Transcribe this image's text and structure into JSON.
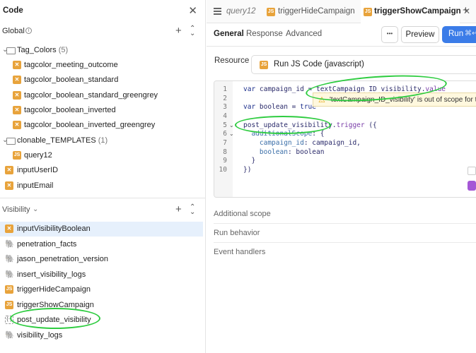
{
  "left": {
    "header_title": "Code",
    "global": {
      "title": "Global",
      "items": [
        {
          "label": "Tag_Colors",
          "count": "(5)",
          "kind": "folder"
        },
        {
          "label": "tagcolor_meeting_outcome",
          "kind": "variable"
        },
        {
          "label": "tagcolor_boolean_standard",
          "kind": "variable"
        },
        {
          "label": "tagcolor_boolean_standard_greengrey",
          "kind": "variable"
        },
        {
          "label": "tagcolor_boolean_inverted",
          "kind": "variable"
        },
        {
          "label": "tagcolor_boolean_inverted_greengrey",
          "kind": "variable"
        },
        {
          "label": "clonable_TEMPLATES",
          "count": "(1)",
          "kind": "folder"
        },
        {
          "label": "query12",
          "kind": "js"
        },
        {
          "label": "inputUserID",
          "kind": "variable"
        },
        {
          "label": "inputEmail",
          "kind": "variable"
        }
      ]
    },
    "visibility": {
      "title": "Visibility",
      "items": [
        {
          "label": "inputVisibilityBoolean",
          "kind": "variable"
        },
        {
          "label": "penetration_facts",
          "kind": "postgres"
        },
        {
          "label": "jason_penetration_version",
          "kind": "postgres"
        },
        {
          "label": "insert_visibility_logs",
          "kind": "postgres"
        },
        {
          "label": "triggerHideCampaign",
          "kind": "js"
        },
        {
          "label": "triggerShowCampaign",
          "kind": "js"
        },
        {
          "label": "post_update_visibility",
          "kind": "workflow"
        },
        {
          "label": "visibility_logs",
          "kind": "postgres"
        }
      ]
    }
  },
  "tabs": {
    "items": [
      "query12",
      "triggerHideCampaign",
      "triggerShowCampaign"
    ],
    "active": "triggerShowCampaign"
  },
  "subtabs": [
    "General",
    "Response",
    "Advanced"
  ],
  "toolbar": {
    "more_label": "•••",
    "preview_label": "Preview",
    "run_label": "Run",
    "run_shortcut": "⌘↵"
  },
  "resource": {
    "label": "Resource",
    "value": "Run JS Code (javascript)"
  },
  "editor": {
    "line_numbers": [
      "1",
      "2",
      "3",
      "4",
      "5",
      "6",
      "7",
      "8",
      "9",
      "10"
    ],
    "warning": "'textCampaign_ID_visibility' is out of scope for this"
  },
  "sections": [
    "Additional scope",
    "Run behavior",
    "Event handlers"
  ],
  "accent_color": "#3b7ce8",
  "annotation_color": "#2ecc40"
}
